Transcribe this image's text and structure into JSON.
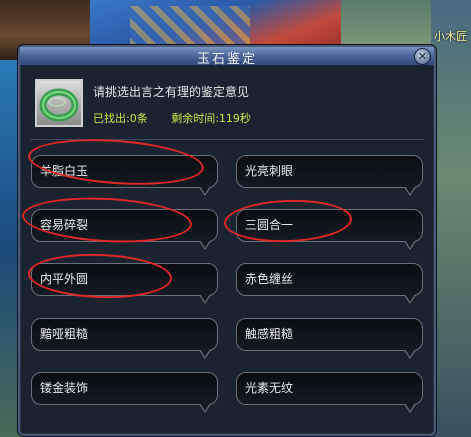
{
  "scene": {
    "npc_name": "小木匠"
  },
  "dialog": {
    "title": "玉石鉴定",
    "close_label": "✕",
    "prompt": "请挑选出言之有理的鉴定意见",
    "found": "已找出:0条",
    "time_left": "剩余时间:119秒"
  },
  "options": [
    {
      "label": "羊脂白玉",
      "circled": true
    },
    {
      "label": "光亮刺眼",
      "circled": false
    },
    {
      "label": "容易碎裂",
      "circled": true
    },
    {
      "label": "三圆合一",
      "circled": true
    },
    {
      "label": "内平外圆",
      "circled": true
    },
    {
      "label": "赤色缠丝",
      "circled": false
    },
    {
      "label": "黯哑粗糙",
      "circled": false
    },
    {
      "label": "触感粗糙",
      "circled": false
    },
    {
      "label": "镂金装饰",
      "circled": false
    },
    {
      "label": "光素无纹",
      "circled": false
    }
  ],
  "annotation_color": "#e02828",
  "item_icon": "jade-bracelet-icon"
}
